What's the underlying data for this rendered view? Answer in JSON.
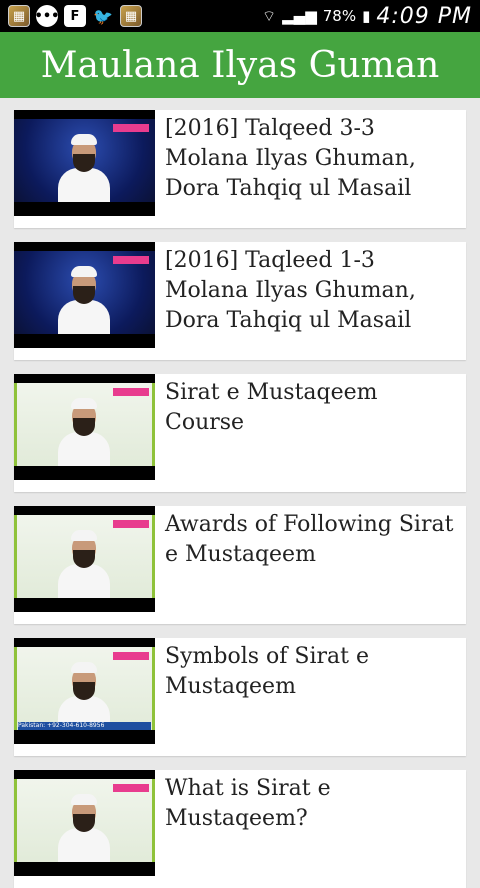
{
  "status_bar": {
    "battery": "78%",
    "time": "4:09 PM",
    "icons": [
      "app-icon",
      "message-icon",
      "flipboard-icon",
      "twitter-icon",
      "app-icon-2",
      "wifi-icon",
      "signal-icon",
      "battery-icon"
    ]
  },
  "app_bar": {
    "title": "Maulana Ilyas Guman"
  },
  "videos": [
    {
      "title": "[2016] Talqeed 3-3 Molana Ilyas Ghuman, Dora Tahqiq ul Masail",
      "theme": "blue"
    },
    {
      "title": "[2016] Taqleed 1-3 Molana Ilyas Ghuman, Dora Tahqiq ul Masail",
      "theme": "blue"
    },
    {
      "title": "Sirat e Mustaqeem Course",
      "theme": "green"
    },
    {
      "title": "Awards of Following Sirat e Mustaqeem",
      "theme": "green"
    },
    {
      "title": "Symbols of Sirat e Mustaqeem",
      "theme": "green",
      "caption": "Pakistan: +92-304-610-8956"
    },
    {
      "title": "What is Sirat e Mustaqeem?",
      "theme": "green"
    }
  ],
  "colors": {
    "app_bar": "#45a540",
    "background": "#e8e8e8",
    "status_bar": "#000000"
  }
}
